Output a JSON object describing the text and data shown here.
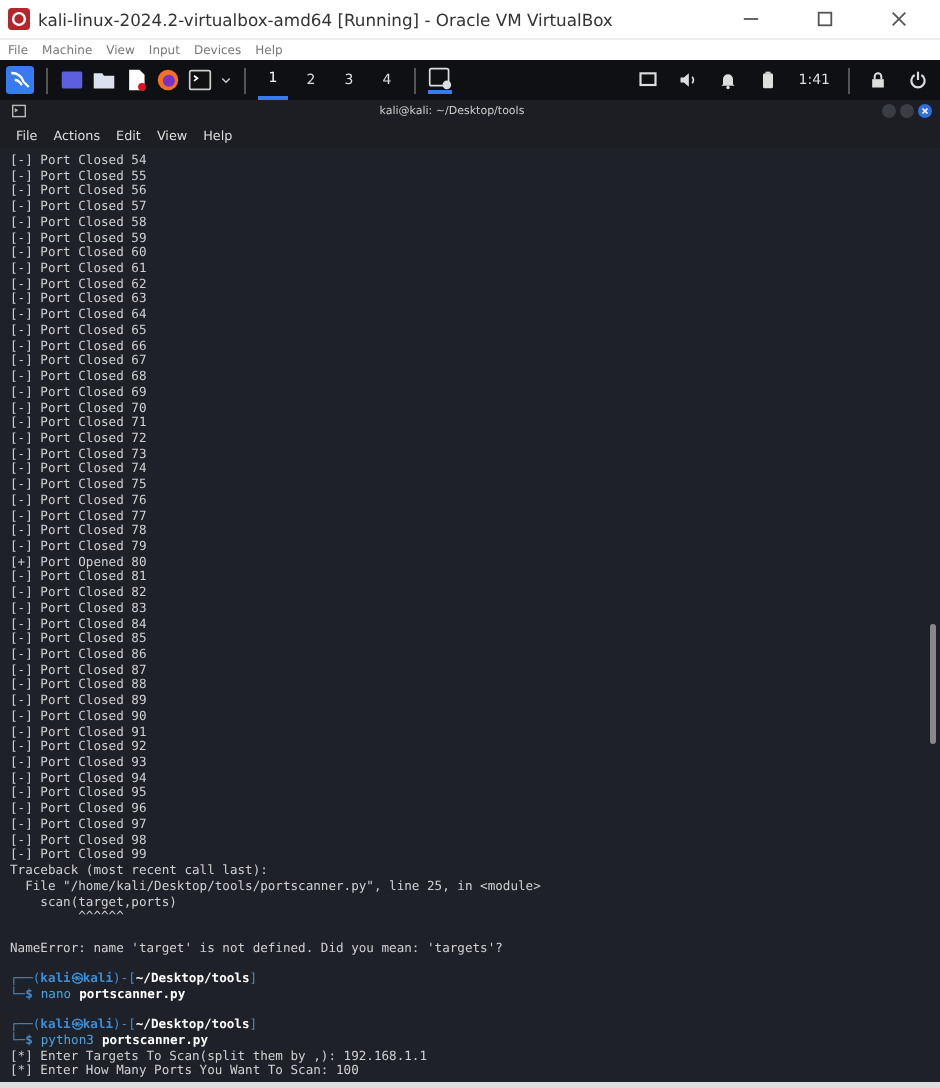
{
  "window": {
    "title": "kali-linux-2024.2-virtualbox-amd64 [Running] - Oracle VM VirtualBox"
  },
  "menu": [
    "File",
    "Machine",
    "View",
    "Input",
    "Devices",
    "Help"
  ],
  "panel": {
    "workspaces": [
      {
        "label": "1",
        "selected": true
      },
      {
        "label": "2",
        "selected": false
      },
      {
        "label": "3",
        "selected": false
      },
      {
        "label": "4",
        "selected": false
      }
    ],
    "clock": "1:41"
  },
  "terminal": {
    "title": "kali@kali: ~/Desktop/tools",
    "menu": [
      "File",
      "Actions",
      "Edit",
      "View",
      "Help"
    ],
    "lines": [
      {
        "kind": "output",
        "text": "[-] Port Closed 54"
      },
      {
        "kind": "output",
        "text": "[-] Port Closed 55"
      },
      {
        "kind": "output",
        "text": "[-] Port Closed 56"
      },
      {
        "kind": "output",
        "text": "[-] Port Closed 57"
      },
      {
        "kind": "output",
        "text": "[-] Port Closed 58"
      },
      {
        "kind": "output",
        "text": "[-] Port Closed 59"
      },
      {
        "kind": "output",
        "text": "[-] Port Closed 60"
      },
      {
        "kind": "output",
        "text": "[-] Port Closed 61"
      },
      {
        "kind": "output",
        "text": "[-] Port Closed 62"
      },
      {
        "kind": "output",
        "text": "[-] Port Closed 63"
      },
      {
        "kind": "output",
        "text": "[-] Port Closed 64"
      },
      {
        "kind": "output",
        "text": "[-] Port Closed 65"
      },
      {
        "kind": "output",
        "text": "[-] Port Closed 66"
      },
      {
        "kind": "output",
        "text": "[-] Port Closed 67"
      },
      {
        "kind": "output",
        "text": "[-] Port Closed 68"
      },
      {
        "kind": "output",
        "text": "[-] Port Closed 69"
      },
      {
        "kind": "output",
        "text": "[-] Port Closed 70"
      },
      {
        "kind": "output",
        "text": "[-] Port Closed 71"
      },
      {
        "kind": "output",
        "text": "[-] Port Closed 72"
      },
      {
        "kind": "output",
        "text": "[-] Port Closed 73"
      },
      {
        "kind": "output",
        "text": "[-] Port Closed 74"
      },
      {
        "kind": "output",
        "text": "[-] Port Closed 75"
      },
      {
        "kind": "output",
        "text": "[-] Port Closed 76"
      },
      {
        "kind": "output",
        "text": "[-] Port Closed 77"
      },
      {
        "kind": "output",
        "text": "[-] Port Closed 78"
      },
      {
        "kind": "output",
        "text": "[-] Port Closed 79"
      },
      {
        "kind": "output",
        "text": "[+] Port Opened 80"
      },
      {
        "kind": "output",
        "text": "[-] Port Closed 81"
      },
      {
        "kind": "output",
        "text": "[-] Port Closed 82"
      },
      {
        "kind": "output",
        "text": "[-] Port Closed 83"
      },
      {
        "kind": "output",
        "text": "[-] Port Closed 84"
      },
      {
        "kind": "output",
        "text": "[-] Port Closed 85"
      },
      {
        "kind": "output",
        "text": "[-] Port Closed 86"
      },
      {
        "kind": "output",
        "text": "[-] Port Closed 87"
      },
      {
        "kind": "output",
        "text": "[-] Port Closed 88"
      },
      {
        "kind": "output",
        "text": "[-] Port Closed 89"
      },
      {
        "kind": "output",
        "text": "[-] Port Closed 90"
      },
      {
        "kind": "output",
        "text": "[-] Port Closed 91"
      },
      {
        "kind": "output",
        "text": "[-] Port Closed 92"
      },
      {
        "kind": "output",
        "text": "[-] Port Closed 93"
      },
      {
        "kind": "output",
        "text": "[-] Port Closed 94"
      },
      {
        "kind": "output",
        "text": "[-] Port Closed 95"
      },
      {
        "kind": "output",
        "text": "[-] Port Closed 96"
      },
      {
        "kind": "output",
        "text": "[-] Port Closed 97"
      },
      {
        "kind": "output",
        "text": "[-] Port Closed 98"
      },
      {
        "kind": "output",
        "text": "[-] Port Closed 99"
      },
      {
        "kind": "output",
        "text": "Traceback (most recent call last):"
      },
      {
        "kind": "output",
        "text": "  File \"/home/kali/Desktop/tools/portscanner.py\", line 25, in <module>"
      },
      {
        "kind": "output",
        "text": "    scan(target,ports)"
      },
      {
        "kind": "output",
        "text": "         ^^^^^^"
      },
      {
        "kind": "blank"
      },
      {
        "kind": "output",
        "text": "NameError: name 'target' is not defined. Did you mean: 'targets'?"
      },
      {
        "kind": "blank"
      },
      {
        "kind": "prompt",
        "parts": [
          {
            "kind": "frame",
            "text": "┌──("
          },
          {
            "kind": "user",
            "text": "kali㉿kali"
          },
          {
            "kind": "frame",
            "text": ")-["
          },
          {
            "kind": "path",
            "text": "~/Desktop/tools"
          },
          {
            "kind": "frame",
            "text": "]"
          }
        ]
      },
      {
        "kind": "prompt",
        "parts": [
          {
            "kind": "frame",
            "text": "└─"
          },
          {
            "kind": "user",
            "text": "$"
          },
          {
            "kind": "command",
            "text": "nano"
          },
          {
            "kind": "arg",
            "text": "portscanner.py"
          }
        ]
      },
      {
        "kind": "blank"
      },
      {
        "kind": "prompt",
        "parts": [
          {
            "kind": "frame",
            "text": "┌──("
          },
          {
            "kind": "user",
            "text": "kali㉿kali"
          },
          {
            "kind": "frame",
            "text": ")-["
          },
          {
            "kind": "path",
            "text": "~/Desktop/tools"
          },
          {
            "kind": "frame",
            "text": "]"
          }
        ]
      },
      {
        "kind": "prompt",
        "parts": [
          {
            "kind": "frame",
            "text": "└─"
          },
          {
            "kind": "user",
            "text": "$"
          },
          {
            "kind": "command",
            "text": "python3"
          },
          {
            "kind": "arg",
            "text": "portscanner.py"
          }
        ]
      },
      {
        "kind": "output",
        "text": "[*] Enter Targets To Scan(split them by ,): 192.168.1.1"
      },
      {
        "kind": "output",
        "text": "[*] Enter How Many Ports You Want To Scan: 100"
      }
    ]
  }
}
